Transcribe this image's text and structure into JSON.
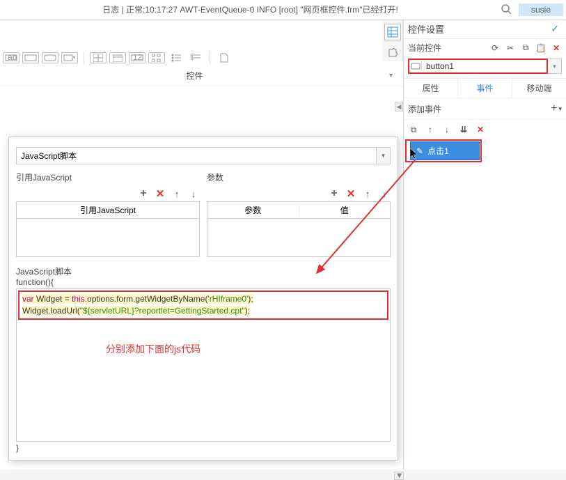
{
  "top": {
    "log_text": "日志 | 正常:10:17:27 AWT-EventQueue-0 INFO [root] \"网页框控件.frm\"已经打开!",
    "username": "susie"
  },
  "widget_section_label": "控件",
  "shadow_header": "",
  "popup": {
    "script_type": "JavaScript脚本",
    "left_col_title": "引用JavaScript",
    "right_col_title": "参数",
    "left_table_head": "引用JavaScript",
    "right_table_head_param": "参数",
    "right_table_head_value": "值",
    "func_label": "JavaScript脚本",
    "func_open": "function(){",
    "code_line1_var": "var",
    "code_line1_mid": " Widget = ",
    "code_line1_this": "this",
    "code_line1_after": ".options.form.getWidgetByName(",
    "code_line1_str": "'rHIframe0'",
    "code_line1_end": ");",
    "code_line2_pre": "Widget.loadUrl(",
    "code_line2_str": "\"${servletURL}?reportlet=GettingStarted.cpt\"",
    "code_line2_end": ");",
    "annotation": "分别添加下面的js代码",
    "func_close": "}"
  },
  "right": {
    "panel_title": "控件设置",
    "current_widget_label": "当前控件",
    "current_widget_value": "button1",
    "tab_property": "属性",
    "tab_event": "事件",
    "tab_mobile": "移动端",
    "add_event_label": "添加事件",
    "event_item_label": "点击1"
  }
}
